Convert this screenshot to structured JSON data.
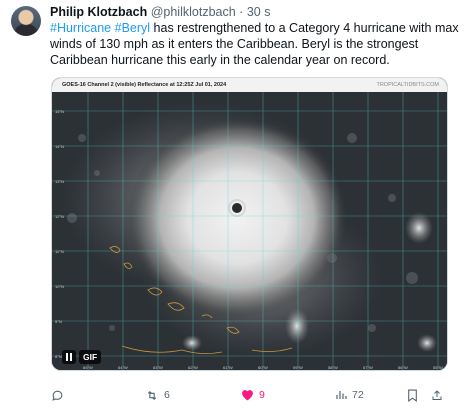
{
  "tweet": {
    "author_name": "Philip Klotzbach",
    "author_handle": "@philklotzbach",
    "separator": "·",
    "time": "30 s",
    "text": {
      "hashtag1": "#Hurricane",
      "hashtag2": "#Beryl",
      "line1_rest": " has restrengthened to a Category 4 hurricane with max",
      "line2": "winds of 130 mph as it enters the Caribbean.  Beryl is the strongest",
      "line3": "Caribbean hurricane this early in the calendar year on record."
    }
  },
  "media": {
    "caption": "GOES-16 Channel 2 (visible) Reflectance at 12:25Z Jul 01, 2024",
    "credit": "TROPICALTIDBITS.COM",
    "gif_label": "GIF",
    "lat_labels": [
      "15°N",
      "14°N",
      "13°N",
      "12°N",
      "11°N",
      "10°N",
      "9°N",
      "8°N"
    ],
    "lon_labels": [
      "65°W",
      "64°W",
      "63°W",
      "62°W",
      "61°W",
      "60°W",
      "59°W",
      "58°W",
      "57°W",
      "56°W",
      "55°W"
    ]
  },
  "actions": {
    "reply_count": "",
    "retweet_count": "6",
    "like_count": "9",
    "views_count": "72"
  },
  "colors": {
    "hashtag": "#1d9bf0",
    "like": "#f91880",
    "muted": "#536471",
    "grid": "#58d6d6",
    "coast": "#d9a441"
  }
}
